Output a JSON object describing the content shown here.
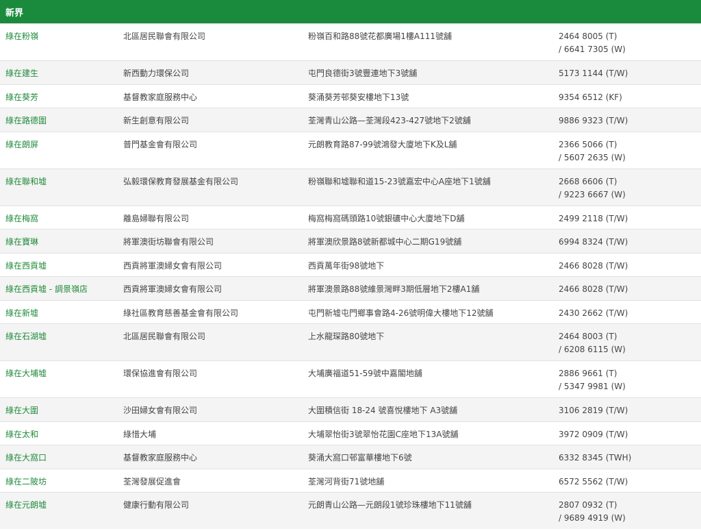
{
  "region_title": "新界",
  "rows": [
    {
      "name": "綠在粉嶺",
      "org": "北區居民聯會有限公司",
      "address": "粉嶺百和路88號花都廣場1樓A111號舖",
      "tel1": "2464 8005 (T)",
      "tel2": "/ 6641 7305 (W)"
    },
    {
      "name": "綠在建生",
      "org": "新西動力環保公司",
      "address": "屯門良德街3號豐連地下3號舖",
      "tel1": "5173 1144 (T/W)",
      "tel2": ""
    },
    {
      "name": "綠在葵芳",
      "org": "基督教家庭服務中心",
      "address": "葵涌葵芳邨葵安樓地下13號",
      "tel1": "9354 6512 (KF)",
      "tel2": ""
    },
    {
      "name": "綠在路德圍",
      "org": "新生創意有限公司",
      "address": "荃灣青山公路—荃灣段423-427號地下2號舖",
      "tel1": "9886 9323 (T/W)",
      "tel2": ""
    },
    {
      "name": "綠在朗屏",
      "org": "普門基金會有限公司",
      "address": "元朗教育路87-99號鴻發大廈地下K及L舖",
      "tel1": "2366 5066 (T)",
      "tel2": "/ 5607 2635 (W)"
    },
    {
      "name": "綠在聯和墟",
      "org": "弘毅環保教育發展基金有限公司",
      "address": "粉嶺聯和墟聯和道15-23號嘉宏中心A座地下1號舖",
      "tel1": "2668 6606 (T)",
      "tel2": "/ 9223 6667 (W)"
    },
    {
      "name": "綠在梅窩",
      "org": "離島婦聯有限公司",
      "address": "梅窩梅窩碼頭路10號銀礦中心大廈地下D舖",
      "tel1": "2499 2118 (T/W)",
      "tel2": ""
    },
    {
      "name": "綠在寶琳",
      "org": "將軍澳街坊聯會有限公司",
      "address": "將軍澳欣景路8號新都城中心二期G19號舖",
      "tel1": "6994 8324 (T/W)",
      "tel2": ""
    },
    {
      "name": "綠在西貢墟",
      "org": "西貢將軍澳婦女會有限公司",
      "address": "西貢萬年街98號地下",
      "tel1": "2466 8028 (T/W)",
      "tel2": ""
    },
    {
      "name": "綠在西貢墟 - 調景嶺店",
      "org": "西貢將軍澳婦女會有限公司",
      "address": "將軍澳景路88號維景灣畔3期低層地下2樓A1舖",
      "tel1": "2466 8028 (T/W)",
      "tel2": ""
    },
    {
      "name": "綠在新墟",
      "org": "綠社區教育慈善基金會有限公司",
      "address": "屯門新墟屯門鄉事會路4-26號明偉大樓地下12號舖",
      "tel1": "2430 2662 (T/W)",
      "tel2": ""
    },
    {
      "name": "綠在石湖墟",
      "org": "北區居民聯會有限公司",
      "address": "上水龍琛路80號地下",
      "tel1": "2464 8003 (T)",
      "tel2": "/ 6208 6115 (W)"
    },
    {
      "name": "綠在大埔墟",
      "org": "環保協進會有限公司",
      "address": "大埔廣福道51-59號中嘉閣地舖",
      "tel1": "2886 9661 (T)",
      "tel2": "/ 5347 9981 (W)"
    },
    {
      "name": "綠在大圍",
      "org": "沙田婦女會有限公司",
      "address": "大圍積信街 18-24 號喜悅樓地下 A3號舖",
      "tel1": "3106 2819 (T/W)",
      "tel2": ""
    },
    {
      "name": "綠在太和",
      "org": "綠惜大埔",
      "address": "大埔翠怡街3號翠怡花園C座地下13A號舖",
      "tel1": "3972 0909 (T/W)",
      "tel2": ""
    },
    {
      "name": "綠在大窩口",
      "org": "基督教家庭服務中心",
      "address": "葵涌大窩口邨富華樓地下6號",
      "tel1": "6332 8345 (TWH)",
      "tel2": ""
    },
    {
      "name": "綠在二陂坊",
      "org": "荃灣發展促進會",
      "address": "荃灣河背街71號地舖",
      "tel1": "6572 5562 (T/W)",
      "tel2": ""
    },
    {
      "name": "綠在元朗墟",
      "org": "健康行動有限公司",
      "address": "元朗青山公路—元朗段1號珍珠樓地下11號舖",
      "tel1": "2807 0932 (T)",
      "tel2": "/ 9689 4919 (W)"
    }
  ]
}
